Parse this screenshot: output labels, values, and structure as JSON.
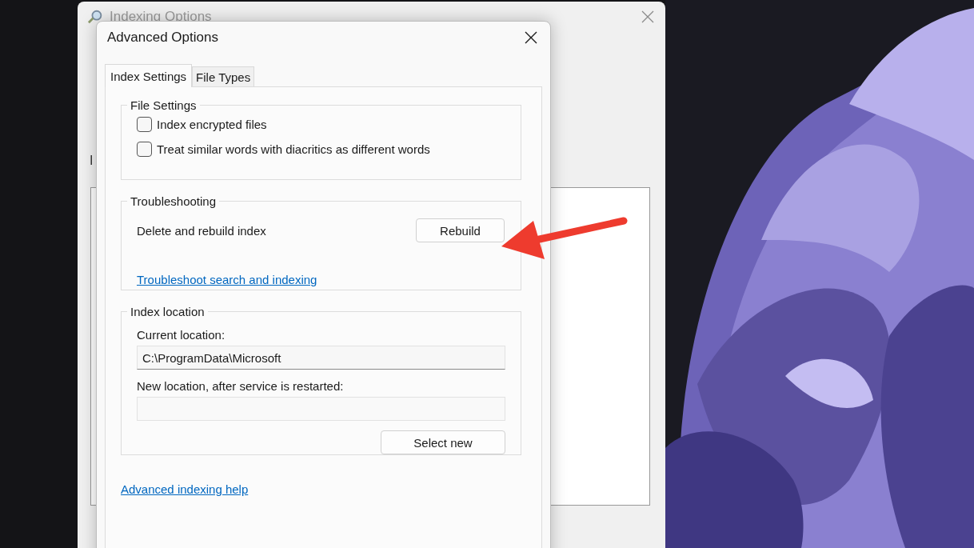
{
  "background_window": {
    "title": "Indexing Options",
    "label": "I"
  },
  "dialog": {
    "title": "Advanced Options",
    "tabs": [
      {
        "label": "Index Settings",
        "selected": true
      },
      {
        "label": "File Types",
        "selected": false
      }
    ],
    "file_settings": {
      "title": "File Settings",
      "options": [
        {
          "label": "Index encrypted files",
          "checked": false
        },
        {
          "label": "Treat similar words with diacritics as different words",
          "checked": false
        }
      ]
    },
    "troubleshooting": {
      "title": "Troubleshooting",
      "text": "Delete and rebuild index",
      "button": "Rebuild",
      "link": "Troubleshoot search and indexing"
    },
    "index_location": {
      "title": "Index location",
      "current_label": "Current location:",
      "current_value": "C:\\ProgramData\\Microsoft",
      "new_label": "New location, after service is restarted:",
      "button": "Select new"
    },
    "help_link": "Advanced indexing help"
  }
}
